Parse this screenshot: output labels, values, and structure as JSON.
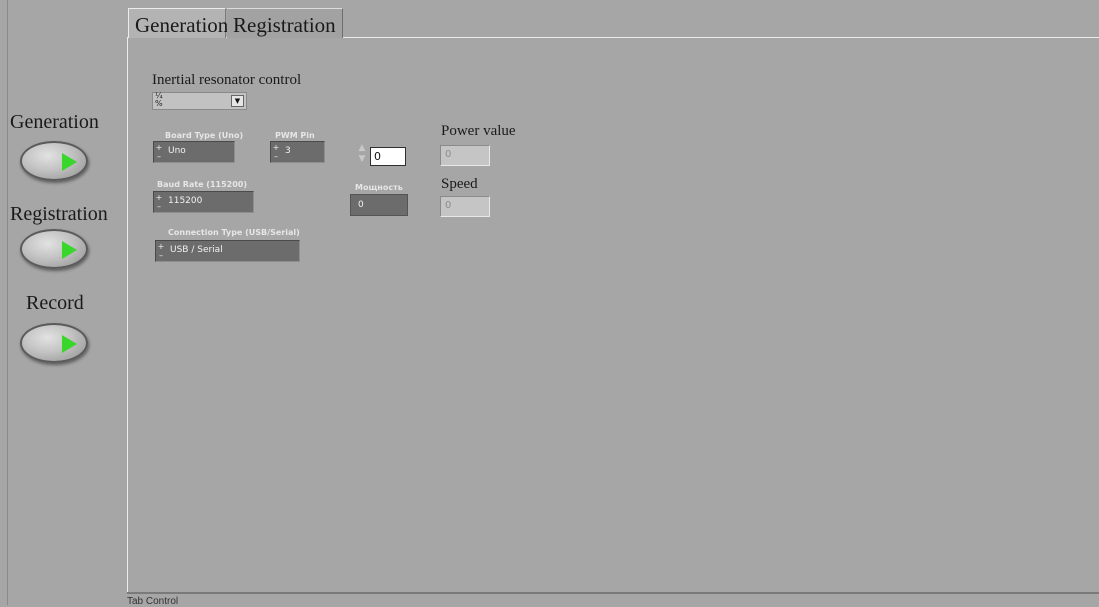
{
  "left_panel": {
    "buttons": [
      {
        "label": "Generation"
      },
      {
        "label": "Registration"
      },
      {
        "label": "Record"
      }
    ]
  },
  "tabs": [
    {
      "label": "Generation",
      "selected": true
    },
    {
      "label": "Registration",
      "selected": false
    }
  ],
  "tab_control_label": "Tab Control",
  "generation_tab": {
    "inertial_resonator_label": "Inertial resonator control",
    "inertial_resonator_value": "",
    "board_type": {
      "label": "Board Type (Uno)",
      "value": "Uno"
    },
    "pwm_pin": {
      "label": "PWM Pin",
      "value": "3"
    },
    "numeric_control_value": "0",
    "baud_rate": {
      "label": "Baud Rate (115200)",
      "value": "115200"
    },
    "power_indicator": {
      "label": "Мощность",
      "value": "0"
    },
    "connection_type": {
      "label": "Connection Type (USB/Serial)",
      "value": "USB / Serial"
    },
    "power_value": {
      "label": "Power value",
      "value": "0"
    },
    "speed": {
      "label": "Speed",
      "value": "0"
    }
  },
  "colors": {
    "background": "#a6a6a6",
    "led_green": "#39d62b",
    "dark_control": "#6c6c6c"
  }
}
